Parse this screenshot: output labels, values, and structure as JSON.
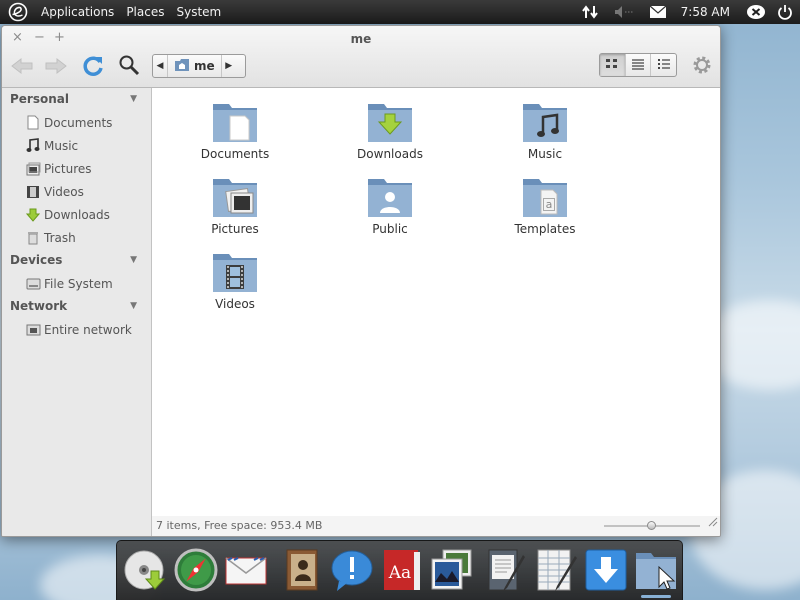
{
  "panel": {
    "menus": [
      "Applications",
      "Places",
      "System"
    ],
    "clock": "7:58 AM",
    "indicators": [
      "network-icon",
      "volume-icon",
      "mail-icon",
      "notification-icon",
      "power-icon"
    ]
  },
  "window": {
    "title": "me",
    "controls": [
      "×",
      "−",
      "+"
    ],
    "path": {
      "crumb": "me"
    }
  },
  "sidebar": {
    "sections": [
      {
        "title": "Personal",
        "items": [
          {
            "label": "Documents",
            "icon": "document-icon"
          },
          {
            "label": "Music",
            "icon": "music-note-icon"
          },
          {
            "label": "Pictures",
            "icon": "picture-icon"
          },
          {
            "label": "Videos",
            "icon": "film-icon"
          },
          {
            "label": "Downloads",
            "icon": "download-arrow-icon"
          },
          {
            "label": "Trash",
            "icon": "trash-icon"
          }
        ]
      },
      {
        "title": "Devices",
        "items": [
          {
            "label": "File System",
            "icon": "harddisk-icon"
          }
        ]
      },
      {
        "title": "Network",
        "items": [
          {
            "label": "Entire network",
            "icon": "network-drive-icon"
          }
        ]
      }
    ]
  },
  "files": [
    {
      "label": "Documents",
      "icon": "folder-documents-icon"
    },
    {
      "label": "Downloads",
      "icon": "folder-downloads-icon"
    },
    {
      "label": "Music",
      "icon": "folder-music-icon"
    },
    {
      "label": "Pictures",
      "icon": "folder-pictures-icon"
    },
    {
      "label": "Public",
      "icon": "folder-public-icon"
    },
    {
      "label": "Templates",
      "icon": "folder-templates-icon"
    },
    {
      "label": "Videos",
      "icon": "folder-videos-icon"
    }
  ],
  "status": {
    "text": "7 items, Free space: 953.4 MB",
    "zoom_level": 0.5
  },
  "colors": {
    "folder": "#8fb0d2",
    "folder_dark": "#5f83ab",
    "accent_green": "#8bc53f"
  },
  "dock": {
    "apps": [
      "disc-installer-icon",
      "web-browser-compass-icon",
      "mail-envelope-icon",
      "contacts-book-icon",
      "chat-bubble-icon",
      "dictionary-icon",
      "photos-icon",
      "text-editor-icon",
      "spreadsheet-icon",
      "downloads-icon",
      "files-folder-icon"
    ]
  }
}
